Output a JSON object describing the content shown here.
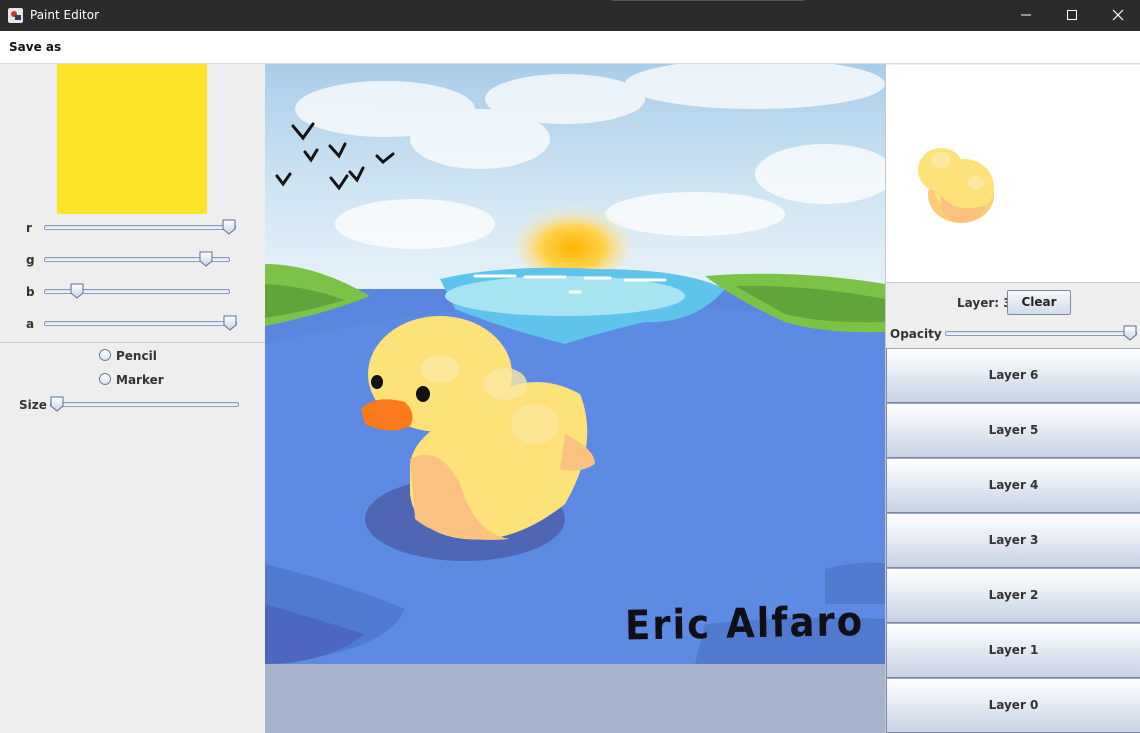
{
  "window": {
    "title": "Paint Editor",
    "minimize_glyph": "—",
    "maximize_glyph": "☐",
    "close_glyph": "✕"
  },
  "menu": {
    "items": [
      "Save as"
    ]
  },
  "color_picker": {
    "current_color": "#fbe428",
    "sliders": [
      {
        "label": "r",
        "value": 1.0
      },
      {
        "label": "g",
        "value": 0.9
      },
      {
        "label": "b",
        "value": 0.15
      },
      {
        "label": "a",
        "value": 1.0
      }
    ]
  },
  "tools": {
    "options": [
      "Pencil",
      "Marker"
    ],
    "selected": null,
    "size_label": "Size",
    "size_value": 0.0
  },
  "canvas": {
    "signature": "Eric Alfaro",
    "colors": {
      "sky": "#cfe6f4",
      "water": "#5a86e0",
      "duck_body": "#fde27a",
      "duck_beak": "#fb7a1c",
      "grass": "#7cc246"
    }
  },
  "layers_panel": {
    "current_layer_label": "Layer: 3",
    "clear_label": "Clear",
    "opacity_label": "Opacity",
    "opacity_value": 1.0,
    "layers": [
      "Layer 6",
      "Layer 5",
      "Layer 4",
      "Layer 3",
      "Layer 2",
      "Layer 1",
      "Layer 0"
    ]
  }
}
